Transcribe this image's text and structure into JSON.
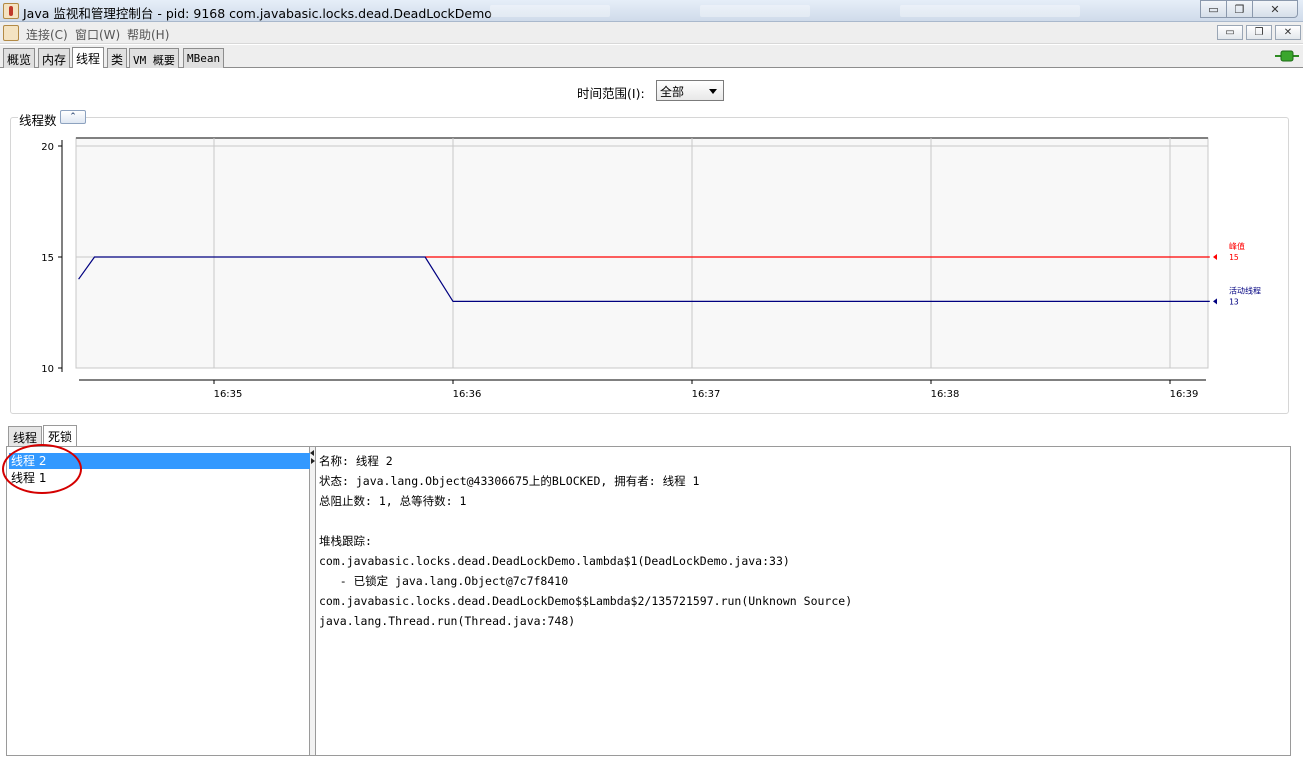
{
  "window": {
    "title": "Java 监视和管理控制台 - pid: 9168 com.javabasic.locks.dead.DeadLockDemo",
    "minimize_symbol": "▭",
    "restore_symbol": "❐",
    "close_symbol": "✕"
  },
  "menu": {
    "items": [
      "连接(C)",
      "窗口(W)",
      "帮助(H)"
    ],
    "inner_buttons": [
      "▭",
      "❐",
      "✕"
    ]
  },
  "tabs": [
    "概览",
    "内存",
    "线程",
    "类",
    "VM 概要",
    "MBean"
  ],
  "active_tab": "线程",
  "time_range": {
    "label": "时间范围(I):",
    "value": "全部"
  },
  "chart_data": {
    "type": "line",
    "title": "线程数",
    "x_ticks": [
      "16:35",
      "16:36",
      "16:37",
      "16:38",
      "16:39"
    ],
    "y_ticks": [
      "20",
      "15",
      "10"
    ],
    "ylim": [
      10,
      20
    ],
    "grid": true,
    "series": [
      {
        "name": "峰值",
        "color": "#ff0000",
        "current_label": "15",
        "points": [
          [
            "16:35:53",
            15
          ],
          [
            "16:39:10",
            15
          ]
        ]
      },
      {
        "name": "活动线程",
        "color": "#000080",
        "current_label": "13",
        "points": [
          [
            "16:34:26",
            14
          ],
          [
            "16:34:30",
            15
          ],
          [
            "16:35:53",
            15
          ],
          [
            "16:36:00",
            13
          ],
          [
            "16:39:10",
            13
          ]
        ]
      }
    ]
  },
  "lower": {
    "subtabs": [
      "线程",
      "死锁"
    ],
    "active_subtab": "死锁",
    "threads": [
      "线程 2",
      "线程 1"
    ],
    "selected_thread": "线程 2",
    "details": [
      "名称: 线程 2",
      "状态: java.lang.Object@43306675上的BLOCKED, 拥有者: 线程 1",
      "总阻止数: 1, 总等待数: 1",
      "",
      "堆栈跟踪:",
      "com.javabasic.locks.dead.DeadLockDemo.lambda$1(DeadLockDemo.java:33)",
      "   - 已锁定 java.lang.Object@7c7f8410",
      "com.javabasic.locks.dead.DeadLockDemo$$Lambda$2/135721597.run(Unknown Source)",
      "java.lang.Thread.run(Thread.java:748)"
    ]
  },
  "colors": {
    "selection": "#3399ff",
    "peak_line": "#ff0000",
    "active_line": "#000080",
    "annotation": "#d40000"
  }
}
